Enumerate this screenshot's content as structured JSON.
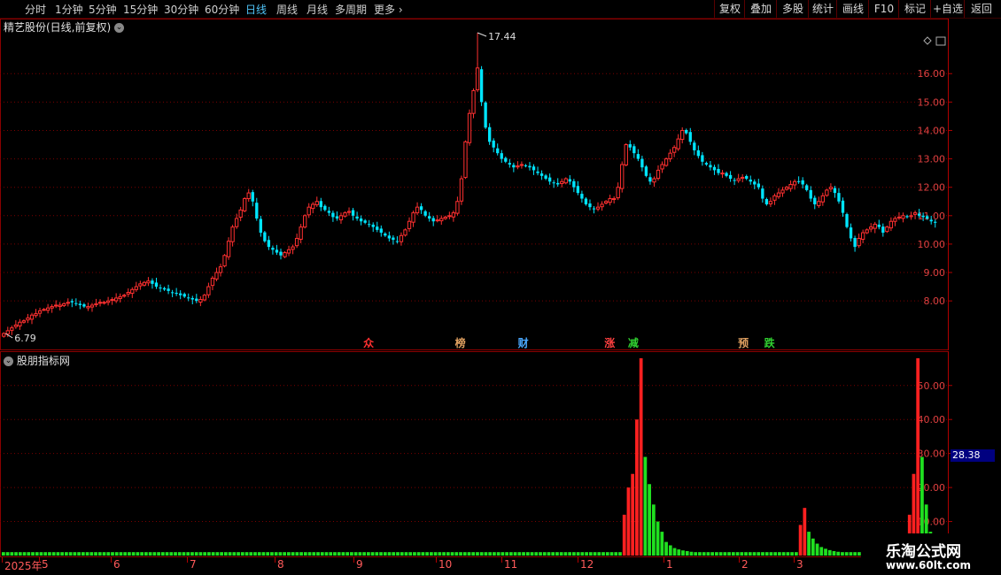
{
  "toolbar": {
    "periods": [
      "分时",
      "1分钟",
      "5分钟",
      "15分钟",
      "30分钟",
      "60分钟",
      "日线",
      "周线",
      "月线",
      "多周期",
      "更多"
    ],
    "active_period": "日线",
    "right_buttons": [
      "复权",
      "叠加",
      "多股",
      "统计",
      "画线",
      "F10",
      "标记",
      "+自选",
      "返回"
    ]
  },
  "price_panel": {
    "title": "精艺股份(日线,前复权)",
    "high_label": "17.44",
    "low_label": "6.79",
    "event_markers": [
      {
        "label": "众",
        "color": "#ff3030",
        "date": "2025-08-26"
      },
      {
        "label": "榜",
        "color": "#e0a060",
        "date": "2025-09-30"
      },
      {
        "label": "财",
        "color": "#4aa8ff",
        "date": "2025-10-24"
      },
      {
        "label": "涨",
        "color": "#ff4040",
        "date": "2025-11-26"
      },
      {
        "label": "减",
        "color": "#30d030",
        "date": "2025-12-05"
      },
      {
        "label": "预",
        "color": "#e0a060",
        "date": "2026-01-16"
      },
      {
        "label": "跌",
        "color": "#30d030",
        "date": "2026-01-26"
      }
    ]
  },
  "indicator_panel": {
    "title": "股朋指标网",
    "current_value": "28.38"
  },
  "time_axis": {
    "labels": [
      "2025年",
      "5",
      "6",
      "7",
      "8",
      "9",
      "10",
      "11",
      "12",
      "1",
      "2",
      "3"
    ]
  },
  "brand": {
    "name": "乐淘公式网",
    "url": "www.60lt.com"
  },
  "chart_data": [
    {
      "type": "candlestick",
      "title": "精艺股份(日线,前复权)",
      "x_range": [
        "2025-04-08",
        "2026-03-31"
      ],
      "y_axis_ticks": [
        8.0,
        9.0,
        10.0,
        11.0,
        12.0,
        13.0,
        14.0,
        15.0,
        16.0
      ],
      "ylim": [
        6.79,
        17.44
      ],
      "up_color": "#ff3030",
      "down_color": "#00e5ff",
      "grid": true,
      "closes": [
        6.85,
        6.95,
        7.05,
        7.15,
        7.25,
        7.3,
        7.4,
        7.5,
        7.55,
        7.65,
        7.7,
        7.75,
        7.8,
        7.85,
        7.85,
        7.9,
        7.95,
        7.95,
        7.9,
        7.85,
        7.8,
        7.8,
        7.85,
        7.9,
        7.95,
        7.95,
        8.0,
        8.05,
        8.1,
        8.15,
        8.2,
        8.3,
        8.4,
        8.5,
        8.6,
        8.65,
        8.7,
        8.6,
        8.5,
        8.45,
        8.4,
        8.35,
        8.3,
        8.25,
        8.2,
        8.15,
        8.1,
        8.05,
        8.0,
        8.05,
        8.2,
        8.5,
        8.8,
        9.0,
        9.2,
        9.6,
        10.1,
        10.6,
        10.9,
        11.2,
        11.6,
        11.8,
        11.5,
        10.9,
        10.4,
        10.1,
        9.9,
        9.8,
        9.7,
        9.6,
        9.7,
        9.8,
        9.9,
        10.2,
        10.6,
        11.0,
        11.3,
        11.4,
        11.5,
        11.3,
        11.2,
        11.1,
        10.95,
        10.9,
        11.0,
        11.1,
        11.15,
        11.0,
        10.9,
        10.8,
        10.75,
        10.7,
        10.6,
        10.5,
        10.4,
        10.3,
        10.2,
        10.15,
        10.1,
        10.3,
        10.5,
        10.8,
        11.1,
        11.3,
        11.2,
        11.0,
        10.9,
        10.8,
        10.85,
        10.9,
        10.95,
        11.0,
        11.1,
        11.5,
        12.3,
        13.6,
        14.6,
        15.4,
        16.2,
        15.0,
        14.1,
        13.6,
        13.4,
        13.2,
        13.0,
        12.9,
        12.8,
        12.7,
        12.75,
        12.8,
        12.75,
        12.7,
        12.6,
        12.5,
        12.4,
        12.3,
        12.2,
        12.15,
        12.1,
        12.2,
        12.3,
        12.2,
        12.0,
        11.8,
        11.6,
        11.4,
        11.3,
        11.25,
        11.3,
        11.4,
        11.5,
        11.6,
        11.6,
        12.0,
        12.8,
        13.5,
        13.4,
        13.2,
        13.0,
        12.7,
        12.4,
        12.2,
        12.3,
        12.6,
        12.8,
        13.0,
        13.2,
        13.4,
        13.7,
        14.0,
        13.9,
        13.6,
        13.3,
        13.1,
        12.9,
        12.8,
        12.7,
        12.6,
        12.5,
        12.5,
        12.4,
        12.3,
        12.25,
        12.3,
        12.35,
        12.3,
        12.2,
        12.1,
        12.0,
        11.6,
        11.4,
        11.5,
        11.7,
        11.8,
        11.9,
        12.0,
        12.1,
        12.2,
        12.2,
        12.1,
        11.9,
        11.6,
        11.4,
        11.5,
        11.7,
        11.9,
        12.0,
        11.8,
        11.5,
        11.1,
        10.6,
        10.2,
        9.9,
        10.2,
        10.4,
        10.5,
        10.6,
        10.7,
        10.6,
        10.4,
        10.6,
        10.8,
        10.9,
        10.95,
        11.0,
        10.95,
        11.0,
        11.1,
        11.0,
        10.95,
        10.9,
        10.8,
        10.75
      ]
    },
    {
      "type": "bar",
      "title": "股朋指标网",
      "y_axis_ticks": [
        10.0,
        20.0,
        30.0,
        40.0,
        50.0
      ],
      "ylim": [
        0,
        58
      ],
      "grid": true,
      "up_color": "#ff2020",
      "down_color": "#20e020",
      "values": [
        1,
        1,
        1,
        1,
        1,
        1,
        1,
        1,
        1,
        1,
        1,
        1,
        1,
        1,
        1,
        1,
        1,
        1,
        1,
        1,
        1,
        1,
        1,
        1,
        1,
        1,
        1,
        1,
        1,
        1,
        1,
        1,
        1,
        1,
        1,
        1,
        1,
        1,
        1,
        1,
        1,
        1,
        1,
        1,
        1,
        1,
        1,
        1,
        1,
        1,
        1,
        1,
        1,
        1,
        1,
        1,
        1,
        1,
        1,
        1,
        1,
        1,
        1,
        1,
        1,
        1,
        1,
        1,
        1,
        1,
        1,
        1,
        1,
        1,
        1,
        1,
        1,
        1,
        1,
        1,
        1,
        1,
        1,
        1,
        1,
        1,
        1,
        1,
        1,
        1,
        1,
        1,
        1,
        1,
        1,
        1,
        1,
        1,
        1,
        1,
        1,
        1,
        1,
        1,
        1,
        1,
        1,
        1,
        1,
        1,
        1,
        1,
        1,
        1,
        1,
        1,
        1,
        1,
        1,
        1,
        1,
        1,
        1,
        1,
        1,
        1,
        1,
        1,
        1,
        1,
        1,
        1,
        1,
        1,
        1,
        1,
        1,
        1,
        1,
        1,
        1,
        1,
        1,
        1,
        1,
        1,
        1,
        1,
        12,
        20,
        24,
        40,
        58,
        29,
        21,
        15,
        10,
        7,
        4,
        3,
        2.2,
        1.8,
        1.5,
        1.3,
        1.1,
        1,
        1,
        1,
        1,
        1,
        1,
        1,
        1,
        1,
        1,
        1,
        1,
        1,
        1,
        1,
        1,
        1,
        1,
        1,
        1,
        1,
        1,
        1,
        1,
        1,
        9,
        14,
        7,
        5,
        3.5,
        2.5,
        2,
        1.6,
        1.3,
        1.1,
        1,
        1,
        1,
        1,
        1,
        1,
        1,
        1,
        1,
        1,
        1,
        1,
        1,
        1,
        1,
        1,
        12,
        24,
        58,
        29,
        15,
        7,
        4
      ],
      "up_flags": [
        false,
        false,
        false,
        false,
        false,
        false,
        false,
        false,
        false,
        false,
        false,
        false,
        false,
        false,
        false,
        false,
        false,
        false,
        false,
        false,
        false,
        false,
        false,
        false,
        false,
        false,
        false,
        false,
        false,
        false,
        false,
        false,
        false,
        false,
        false,
        false,
        false,
        false,
        false,
        false,
        false,
        false,
        false,
        false,
        false,
        false,
        false,
        false,
        false,
        false,
        false,
        false,
        false,
        false,
        false,
        false,
        false,
        false,
        false,
        false,
        false,
        false,
        false,
        false,
        false,
        false,
        false,
        false,
        false,
        false,
        false,
        false,
        false,
        false,
        false,
        false,
        false,
        false,
        false,
        false,
        false,
        false,
        false,
        false,
        false,
        false,
        false,
        false,
        false,
        false,
        false,
        false,
        false,
        false,
        false,
        false,
        false,
        false,
        false,
        false,
        false,
        false,
        false,
        false,
        false,
        false,
        false,
        false,
        false,
        false,
        false,
        false,
        false,
        false,
        false,
        false,
        false,
        false,
        false,
        false,
        false,
        false,
        false,
        false,
        false,
        false,
        false,
        false,
        false,
        false,
        false,
        false,
        false,
        false,
        false,
        false,
        false,
        false,
        false,
        false,
        false,
        false,
        false,
        false,
        false,
        false,
        false,
        false,
        true,
        true,
        true,
        true,
        true,
        false,
        false,
        false,
        false,
        false,
        false,
        false,
        false,
        false,
        false,
        false,
        false,
        false,
        false,
        false,
        false,
        false,
        false,
        false,
        false,
        false,
        false,
        false,
        false,
        false,
        false,
        false,
        false,
        false,
        false,
        false,
        false,
        false,
        false,
        false,
        false,
        false,
        true,
        true,
        false,
        false,
        false,
        false,
        false,
        false,
        false,
        false,
        false,
        false,
        false,
        false,
        false,
        false,
        false,
        false,
        false,
        false,
        false,
        false,
        false,
        false,
        false,
        false,
        true,
        true,
        true,
        false,
        false,
        false,
        false
      ]
    }
  ]
}
